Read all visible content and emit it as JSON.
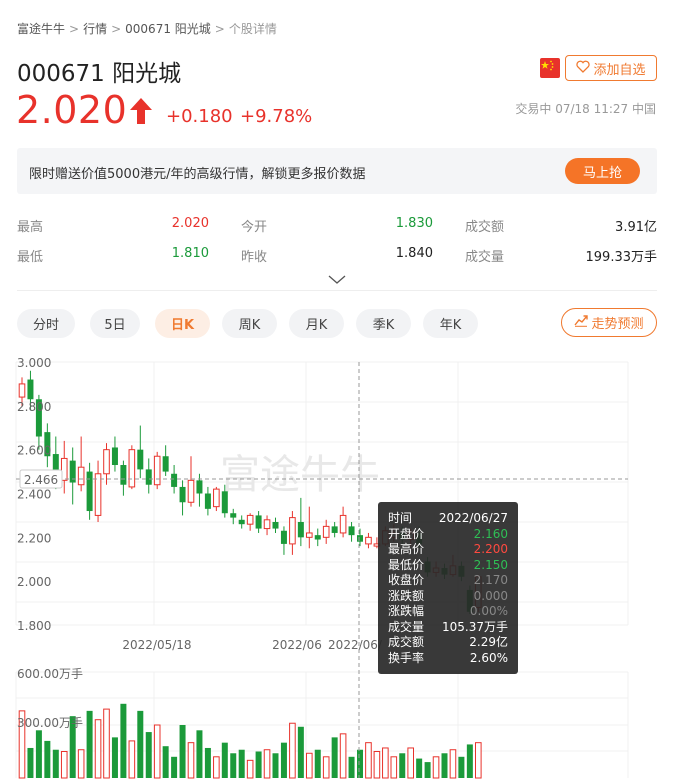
{
  "breadcrumb": [
    "富途牛牛",
    "行情",
    "000671 阳光城",
    "个股详情"
  ],
  "stock": {
    "title": "000671 阳光城",
    "price": "2.020",
    "change": "+0.180",
    "change_pct": "+9.78%",
    "status": "交易中 07/18 11:27 中国",
    "watch_label": "添加自选"
  },
  "promo": {
    "text": "限时赠送价值5000港元/年的高级行情，解锁更多报价数据",
    "button": "马上抢"
  },
  "quote": [
    {
      "label": "最高",
      "value": "2.020",
      "color": "red"
    },
    {
      "label": "今开",
      "value": "1.830",
      "color": "green"
    },
    {
      "label": "成交额",
      "value": "3.91亿",
      "color": "dark"
    },
    {
      "label": "最低",
      "value": "1.810",
      "color": "green"
    },
    {
      "label": "昨收",
      "value": "1.840",
      "color": "dark"
    },
    {
      "label": "成交量",
      "value": "199.33万手",
      "color": "dark"
    }
  ],
  "tabs": [
    "分时",
    "5日",
    "日K",
    "周K",
    "月K",
    "季K",
    "年K"
  ],
  "active_tab": "日K",
  "forecast_label": "走势预测",
  "watermark": "富途牛牛",
  "colors": {
    "up": "#e8322b",
    "down": "#1b9a3a",
    "accent": "#f07a30"
  },
  "chart_data": {
    "type": "candlestick",
    "ylim": [
      1.8,
      3.0
    ],
    "yticks": [
      "3.000",
      "2.800",
      "2.600",
      "2.400",
      "2.200",
      "2.000",
      "1.800"
    ],
    "xticks": [
      "2022/05/18",
      "2022/06",
      "2022/06/"
    ],
    "crosshair_value": "2.466",
    "candles": [
      {
        "o": 2.84,
        "c": 2.9,
        "h": 2.93,
        "l": 2.8
      },
      {
        "o": 2.92,
        "c": 2.83,
        "h": 2.96,
        "l": 2.78
      },
      {
        "o": 2.83,
        "c": 2.66,
        "h": 2.85,
        "l": 2.6
      },
      {
        "o": 2.68,
        "c": 2.57,
        "h": 2.72,
        "l": 2.52
      },
      {
        "o": 2.58,
        "c": 2.47,
        "h": 2.66,
        "l": 2.42
      },
      {
        "o": 2.46,
        "c": 2.56,
        "h": 2.64,
        "l": 2.4
      },
      {
        "o": 2.55,
        "c": 2.45,
        "h": 2.61,
        "l": 2.35
      },
      {
        "o": 2.44,
        "c": 2.52,
        "h": 2.66,
        "l": 2.41
      },
      {
        "o": 2.5,
        "c": 2.32,
        "h": 2.54,
        "l": 2.28
      },
      {
        "o": 2.3,
        "c": 2.49,
        "h": 2.55,
        "l": 2.27
      },
      {
        "o": 2.49,
        "c": 2.6,
        "h": 2.63,
        "l": 2.44
      },
      {
        "o": 2.61,
        "c": 2.53,
        "h": 2.66,
        "l": 2.5
      },
      {
        "o": 2.53,
        "c": 2.44,
        "h": 2.55,
        "l": 2.39
      },
      {
        "o": 2.43,
        "c": 2.6,
        "h": 2.62,
        "l": 2.42
      },
      {
        "o": 2.6,
        "c": 2.51,
        "h": 2.71,
        "l": 2.47
      },
      {
        "o": 2.51,
        "c": 2.44,
        "h": 2.56,
        "l": 2.4
      },
      {
        "o": 2.44,
        "c": 2.57,
        "h": 2.59,
        "l": 2.42
      },
      {
        "o": 2.57,
        "c": 2.5,
        "h": 2.62,
        "l": 2.48
      },
      {
        "o": 2.49,
        "c": 2.43,
        "h": 2.53,
        "l": 2.4
      },
      {
        "o": 2.43,
        "c": 2.36,
        "h": 2.46,
        "l": 2.3
      },
      {
        "o": 2.36,
        "c": 2.46,
        "h": 2.57,
        "l": 2.34
      },
      {
        "o": 2.46,
        "c": 2.4,
        "h": 2.49,
        "l": 2.34
      },
      {
        "o": 2.4,
        "c": 2.33,
        "h": 2.43,
        "l": 2.3
      },
      {
        "o": 2.34,
        "c": 2.42,
        "h": 2.43,
        "l": 2.32
      },
      {
        "o": 2.41,
        "c": 2.31,
        "h": 2.44,
        "l": 2.29
      },
      {
        "o": 2.31,
        "c": 2.29,
        "h": 2.33,
        "l": 2.26
      },
      {
        "o": 2.28,
        "c": 2.26,
        "h": 2.3,
        "l": 2.24
      },
      {
        "o": 2.26,
        "c": 2.3,
        "h": 2.31,
        "l": 2.23
      },
      {
        "o": 2.3,
        "c": 2.24,
        "h": 2.32,
        "l": 2.22
      },
      {
        "o": 2.24,
        "c": 2.28,
        "h": 2.3,
        "l": 2.21
      },
      {
        "o": 2.27,
        "c": 2.24,
        "h": 2.29,
        "l": 2.22
      },
      {
        "o": 2.23,
        "c": 2.17,
        "h": 2.25,
        "l": 2.12
      },
      {
        "o": 2.17,
        "c": 2.29,
        "h": 2.32,
        "l": 2.12
      },
      {
        "o": 2.27,
        "c": 2.2,
        "h": 2.38,
        "l": 2.16
      },
      {
        "o": 2.2,
        "c": 2.22,
        "h": 2.34,
        "l": 2.15
      },
      {
        "o": 2.21,
        "c": 2.19,
        "h": 2.24,
        "l": 2.16
      },
      {
        "o": 2.2,
        "c": 2.25,
        "h": 2.28,
        "l": 2.17
      },
      {
        "o": 2.25,
        "c": 2.22,
        "h": 2.27,
        "l": 2.2
      },
      {
        "o": 2.22,
        "c": 2.3,
        "h": 2.34,
        "l": 2.2
      },
      {
        "o": 2.25,
        "c": 2.21,
        "h": 2.27,
        "l": 2.18
      },
      {
        "o": 2.21,
        "c": 2.18,
        "h": 2.24,
        "l": 2.16
      },
      {
        "o": 2.17,
        "c": 2.2,
        "h": 2.22,
        "l": 2.15
      },
      {
        "o": 2.16,
        "c": 2.17,
        "h": 2.2,
        "l": 2.15
      },
      {
        "o": 2.17,
        "c": 2.23,
        "h": 2.25,
        "l": 2.16
      },
      {
        "o": 2.2,
        "c": 2.22,
        "h": 2.26,
        "l": 2.18
      },
      {
        "o": 2.22,
        "c": 2.19,
        "h": 2.25,
        "l": 2.17
      },
      {
        "o": 2.19,
        "c": 2.22,
        "h": 2.24,
        "l": 2.16
      },
      {
        "o": 2.22,
        "c": 2.17,
        "h": 2.25,
        "l": 2.15
      },
      {
        "o": 2.09,
        "c": 2.04,
        "h": 2.11,
        "l": 2.02
      },
      {
        "o": 2.04,
        "c": 2.06,
        "h": 2.09,
        "l": 2.02
      },
      {
        "o": 2.06,
        "c": 2.03,
        "h": 2.08,
        "l": 2.01
      },
      {
        "o": 2.03,
        "c": 2.07,
        "h": 2.12,
        "l": 2.02
      },
      {
        "o": 2.07,
        "c": 2.02,
        "h": 2.09,
        "l": 2.0
      },
      {
        "o": 1.96,
        "c": 1.86,
        "h": 1.98,
        "l": 1.85
      },
      {
        "o": 1.88,
        "c": 2.02,
        "h": 2.03,
        "l": 1.86
      }
    ],
    "volume": {
      "ylabel_top": "600.00万手",
      "ylabel_mid": "300.00万手",
      "max": 600,
      "values": [
        380,
        170,
        270,
        210,
        160,
        150,
        350,
        160,
        380,
        330,
        390,
        230,
        420,
        210,
        380,
        260,
        300,
        180,
        120,
        300,
        200,
        270,
        170,
        120,
        200,
        140,
        160,
        100,
        150,
        160,
        140,
        200,
        310,
        290,
        140,
        160,
        120,
        230,
        250,
        120,
        160,
        200,
        150,
        170,
        120,
        140,
        170,
        110,
        90,
        120,
        140,
        160,
        120,
        190,
        200
      ]
    }
  },
  "tooltip": [
    {
      "label": "时间",
      "value": "2022/06/27",
      "tone": "white"
    },
    {
      "label": "开盘价",
      "value": "2.160",
      "tone": "green"
    },
    {
      "label": "最高价",
      "value": "2.200",
      "tone": "red"
    },
    {
      "label": "最低价",
      "value": "2.150",
      "tone": "green"
    },
    {
      "label": "收盘价",
      "value": "2.170",
      "tone": "grey"
    },
    {
      "label": "涨跌额",
      "value": "0.000",
      "tone": "grey"
    },
    {
      "label": "涨跌幅",
      "value": "0.00%",
      "tone": "grey"
    },
    {
      "label": "成交量",
      "value": "105.37万手",
      "tone": "white"
    },
    {
      "label": "成交额",
      "value": "2.29亿",
      "tone": "white"
    },
    {
      "label": "换手率",
      "value": "2.60%",
      "tone": "white"
    }
  ]
}
